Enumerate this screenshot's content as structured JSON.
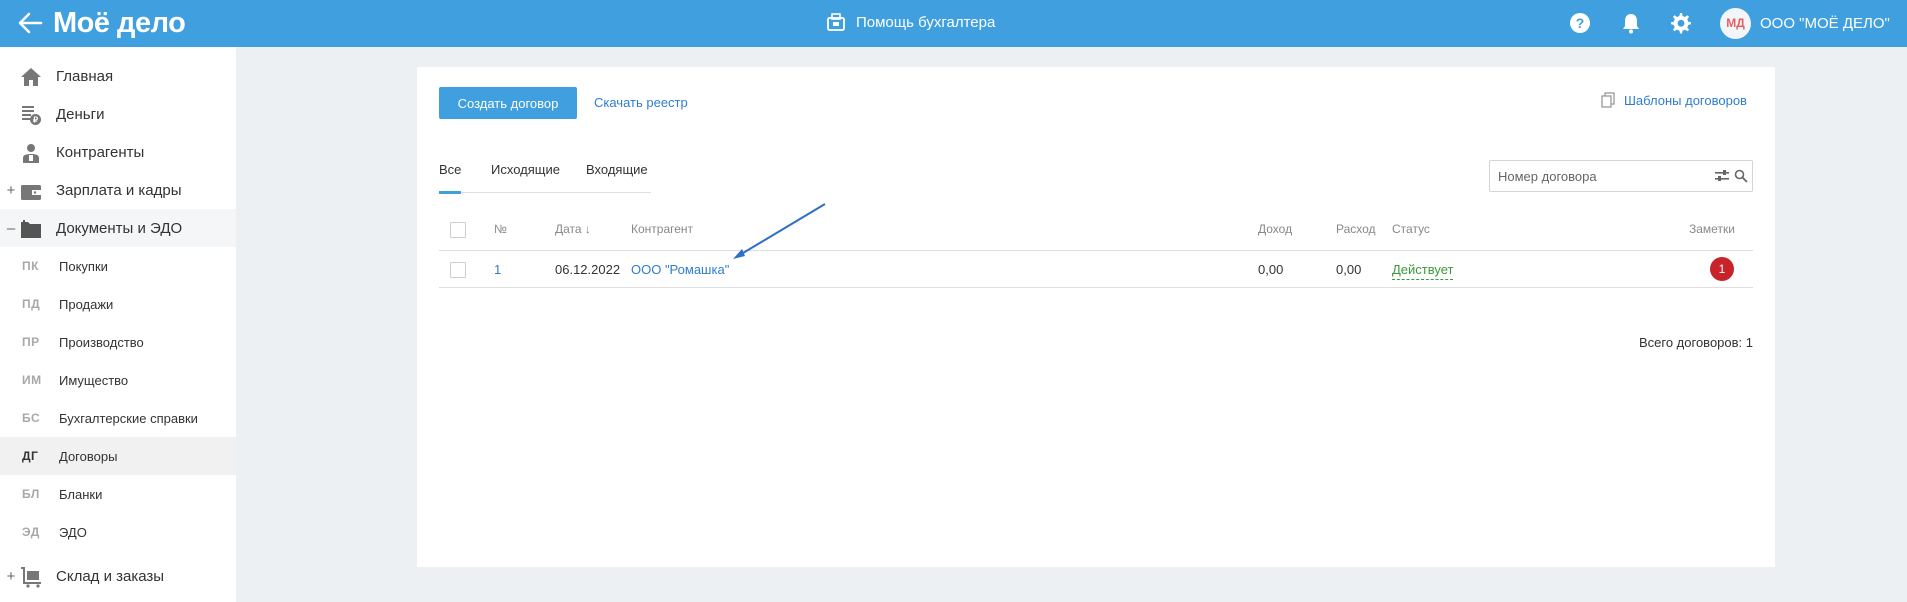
{
  "header": {
    "logo": "Моё дело",
    "center_title": "Помощь бухгалтера",
    "company": "ООО \"МОЁ ДЕЛО\"",
    "avatar_initials": "МД",
    "brand_color": "#3f9fdf"
  },
  "sidebar": {
    "items": [
      {
        "label": "Главная",
        "icon": "home-icon"
      },
      {
        "label": "Деньги",
        "icon": "money-icon"
      },
      {
        "label": "Контрагенты",
        "icon": "contractors-icon"
      },
      {
        "label": "Зарплата и кадры",
        "icon": "wallet-icon",
        "expander": "+"
      },
      {
        "label": "Документы и ЭДО",
        "icon": "folder-icon",
        "expander": "–"
      },
      {
        "label": "Склад и заказы",
        "icon": "cart-icon",
        "expander": "+"
      }
    ],
    "subitems": [
      {
        "abbr": "ПК",
        "label": "Покупки"
      },
      {
        "abbr": "ПД",
        "label": "Продажи"
      },
      {
        "abbr": "ПР",
        "label": "Производство"
      },
      {
        "abbr": "ИМ",
        "label": "Имущество"
      },
      {
        "abbr": "БС",
        "label": "Бухгалтерские справки"
      },
      {
        "abbr": "ДГ",
        "label": "Договоры"
      },
      {
        "abbr": "БЛ",
        "label": "Бланки"
      },
      {
        "abbr": "ЭД",
        "label": "ЭДО"
      }
    ]
  },
  "main": {
    "create_button": "Создать договор",
    "download_link": "Скачать реестр",
    "templates_link": "Шаблоны договоров",
    "tabs": [
      "Все",
      "Исходящие",
      "Входящие"
    ],
    "search": {
      "placeholder": "Номер договора",
      "value": ""
    },
    "table": {
      "columns": [
        "№",
        "Дата ↓",
        "Контрагент",
        "Доход",
        "Расход",
        "Статус",
        "Заметки"
      ],
      "rows": [
        {
          "number": "1",
          "date": "06.12.2022",
          "contractor": "ООО \"Ромашка\"",
          "income": "0,00",
          "expense": "0,00",
          "status": "Действует",
          "notes": "1"
        }
      ]
    },
    "total": "Всего договоров: 1"
  }
}
